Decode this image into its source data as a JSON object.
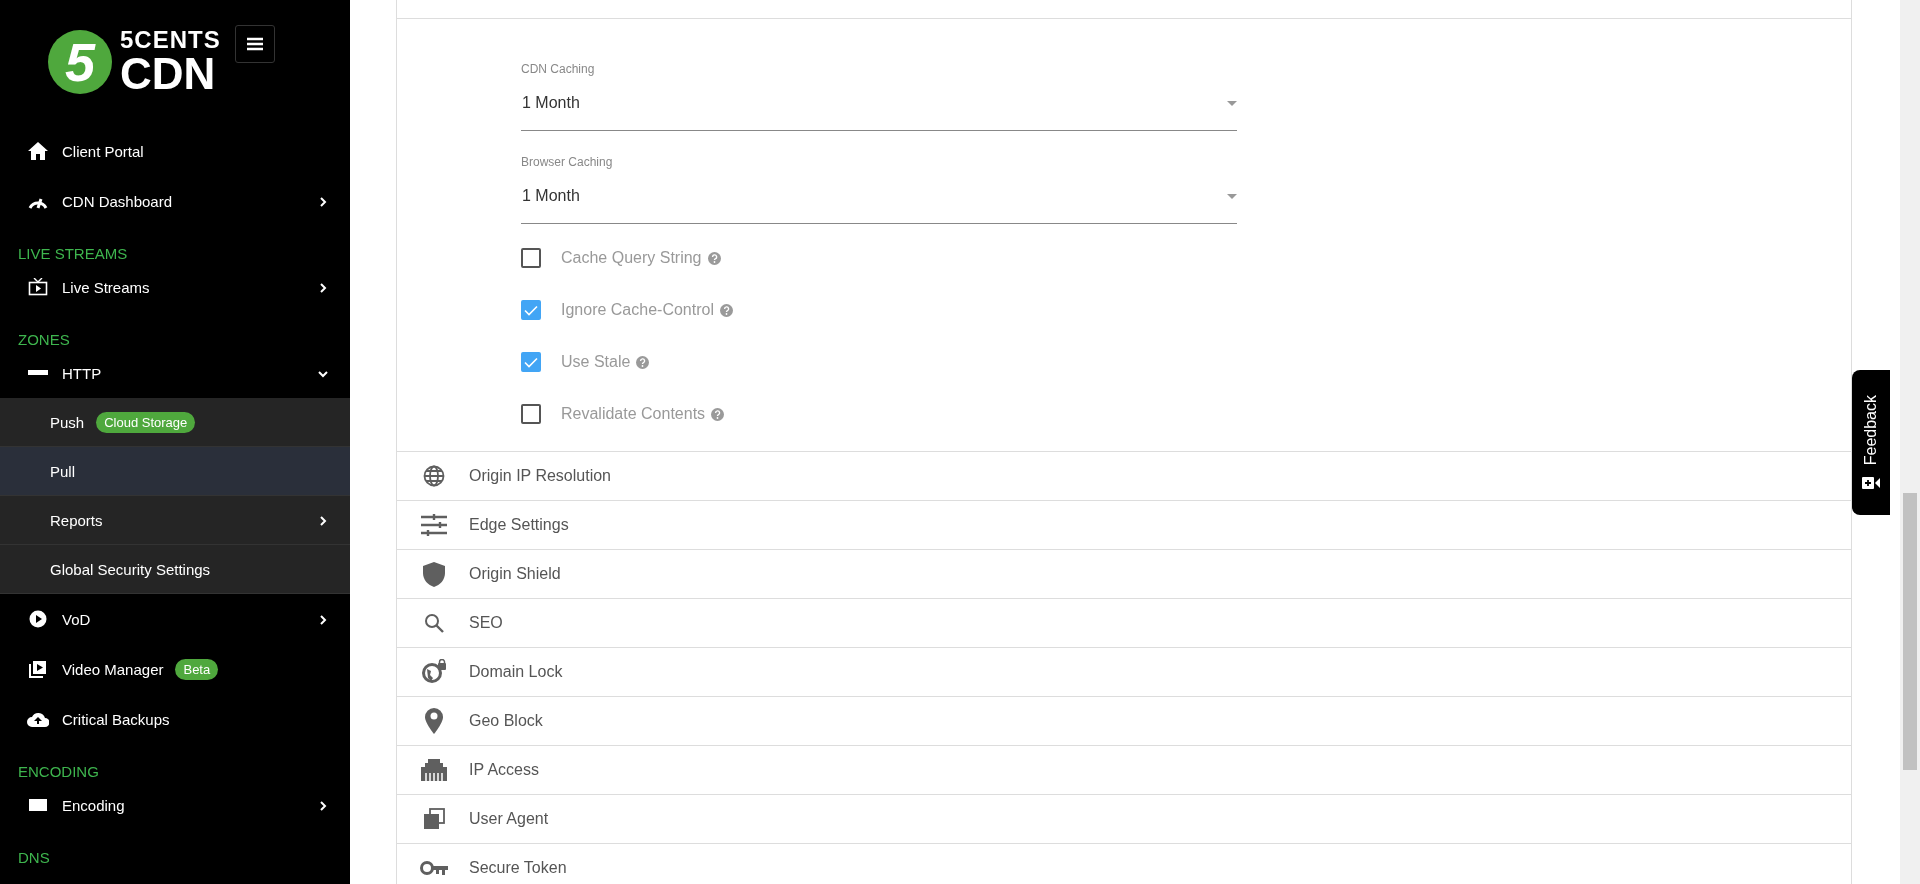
{
  "sidebar": {
    "logo": {
      "mark": "5",
      "line1": "5CENTS",
      "line2": "CDN"
    },
    "items": [
      {
        "kind": "link",
        "label": "Client Portal"
      },
      {
        "kind": "link",
        "label": "CDN Dashboard",
        "expanded": false
      },
      {
        "kind": "section",
        "label": "LIVE STREAMS"
      },
      {
        "kind": "link",
        "label": "Live Streams",
        "expanded": false
      },
      {
        "kind": "section",
        "label": "ZONES"
      },
      {
        "kind": "link",
        "label": "HTTP",
        "expanded": true,
        "children": [
          {
            "label": "Push",
            "badge": "Cloud Storage",
            "selected": false
          },
          {
            "label": "Pull",
            "selected": true
          },
          {
            "label": "Reports",
            "expanded": false,
            "selected": false
          },
          {
            "label": "Global Security Settings",
            "selected": false
          }
        ]
      },
      {
        "kind": "link",
        "label": "VoD",
        "expanded": false
      },
      {
        "kind": "link",
        "label": "Video Manager",
        "badge": "Beta"
      },
      {
        "kind": "link",
        "label": "Critical Backups"
      },
      {
        "kind": "section",
        "label": "ENCODING"
      },
      {
        "kind": "link",
        "label": "Encoding",
        "expanded": false
      },
      {
        "kind": "section",
        "label": "DNS"
      }
    ]
  },
  "caching": {
    "selects": [
      {
        "label": "CDN Caching",
        "value": "1 Month"
      },
      {
        "label": "Browser Caching",
        "value": "1 Month"
      }
    ],
    "checkboxes": [
      {
        "label": "Cache Query String",
        "checked": false
      },
      {
        "label": "Ignore Cache-Control",
        "checked": true
      },
      {
        "label": "Use Stale",
        "checked": true
      },
      {
        "label": "Revalidate Contents",
        "checked": false
      }
    ]
  },
  "sections": [
    {
      "label": "Origin IP Resolution"
    },
    {
      "label": "Edge Settings"
    },
    {
      "label": "Origin Shield"
    },
    {
      "label": "SEO"
    },
    {
      "label": "Domain Lock"
    },
    {
      "label": "Geo Block"
    },
    {
      "label": "IP Access"
    },
    {
      "label": "User Agent"
    },
    {
      "label": "Secure Token"
    }
  ],
  "feedback": {
    "label": "Feedback"
  }
}
